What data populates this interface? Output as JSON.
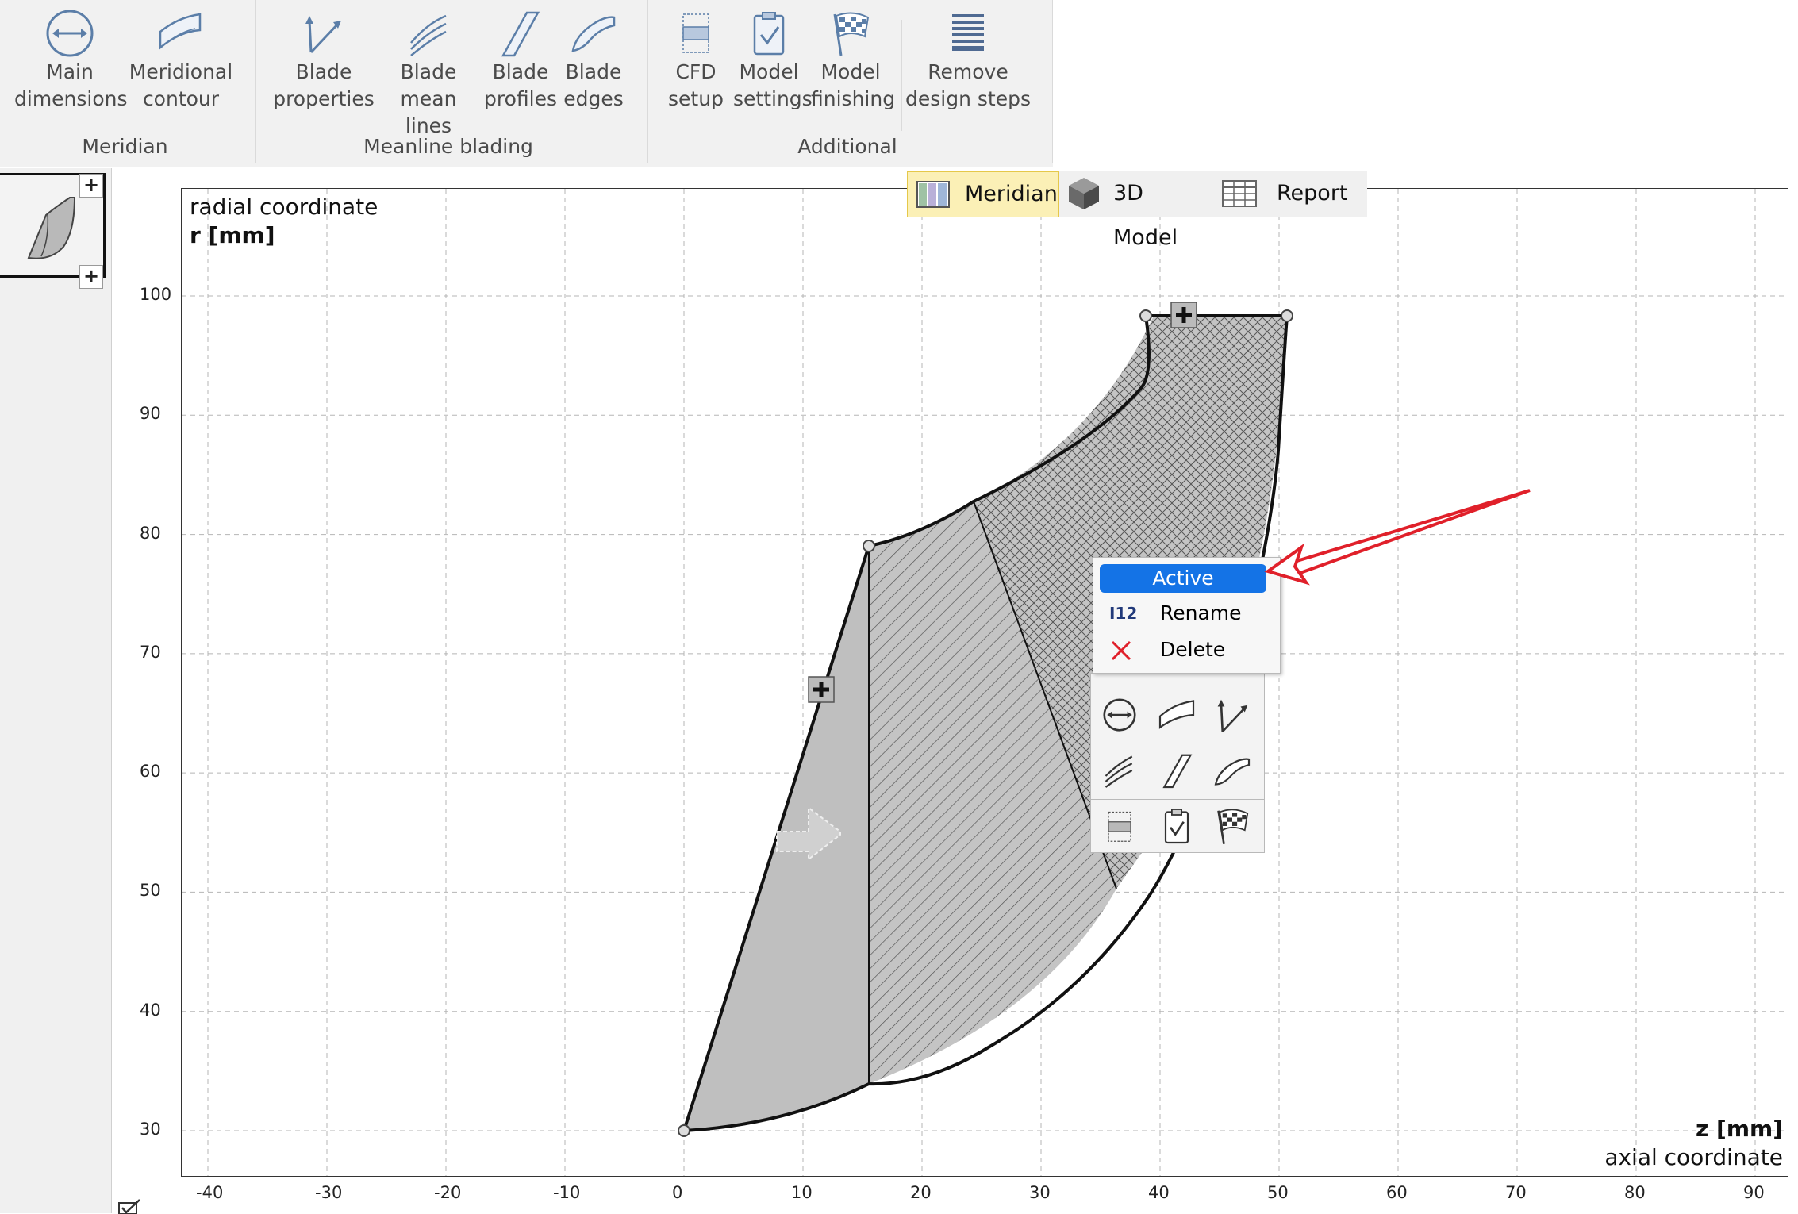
{
  "ribbon": {
    "groups": [
      {
        "label": "Meridian",
        "buttons": [
          {
            "line1": "Main",
            "line2": "dimensions",
            "icon": "main-dimensions-icon"
          },
          {
            "line1": "Meridional",
            "line2": "contour",
            "icon": "meridional-contour-icon"
          }
        ]
      },
      {
        "label": "Meanline blading",
        "buttons": [
          {
            "line1": "Blade",
            "line2": "properties",
            "icon": "blade-properties-icon"
          },
          {
            "line1": "Blade",
            "line2": "mean lines",
            "icon": "blade-mean-lines-icon"
          },
          {
            "line1": "Blade",
            "line2": "profiles",
            "icon": "blade-profiles-icon"
          },
          {
            "line1": "Blade",
            "line2": "edges",
            "icon": "blade-edges-icon"
          }
        ]
      },
      {
        "label": "Additional",
        "buttons": [
          {
            "line1": "CFD",
            "line2": "setup",
            "icon": "cfd-setup-icon"
          },
          {
            "line1": "Model",
            "line2": "settings",
            "icon": "model-settings-icon"
          },
          {
            "line1": "Model",
            "line2": "finishing",
            "icon": "model-finishing-icon"
          },
          {
            "line1": "Remove",
            "line2": "design steps",
            "icon": "remove-design-steps-icon"
          }
        ]
      }
    ]
  },
  "view_tabs": [
    {
      "label": "Meridian",
      "active": true,
      "icon": "meridian-view-icon"
    },
    {
      "label": "3D Model",
      "active": false,
      "icon": "cube-icon"
    },
    {
      "label": "Report",
      "active": false,
      "icon": "table-icon"
    }
  ],
  "context_menu": {
    "items": [
      {
        "label": "Active",
        "highlighted": true
      },
      {
        "label": "Rename",
        "icon": "rename-icon",
        "icon_text": "12"
      },
      {
        "label": "Delete",
        "icon": "delete-x-icon"
      }
    ]
  },
  "chart_data": {
    "type": "scatter",
    "ylabel_line1": "radial coordinate",
    "ylabel_line2": "r [mm]",
    "xlabel_line1": "z [mm]",
    "xlabel_line2": "axial coordinate",
    "xlim": [
      -42,
      92
    ],
    "ylim": [
      28.5,
      110
    ],
    "x_ticks": [
      -40,
      -30,
      -20,
      -10,
      0,
      10,
      20,
      30,
      40,
      50,
      60,
      70,
      80,
      90
    ],
    "y_ticks": [
      30,
      40,
      50,
      60,
      70,
      80,
      90,
      100
    ],
    "grid": true,
    "series": [
      {
        "points": [
          [
            0,
            30
          ],
          [
            15.5,
            79
          ],
          [
            39,
            105
          ],
          [
            50.5,
            105
          ]
        ]
      }
    ]
  },
  "colors": {
    "accent_blue": "#1473e6",
    "highlight_tab": "#fbf0b6",
    "arrow_red": "#e0202a",
    "shape_gray": "#bdbdbd"
  }
}
